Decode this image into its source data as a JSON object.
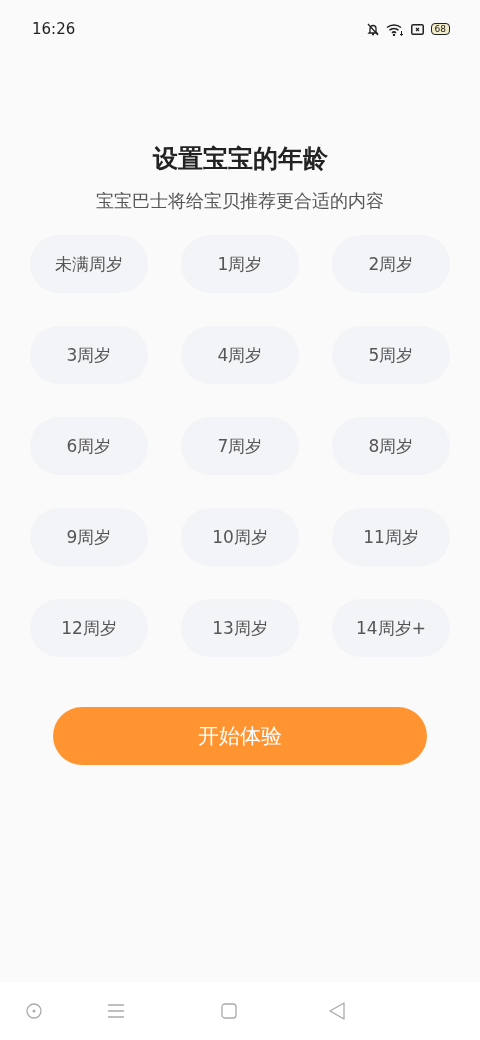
{
  "status_bar": {
    "time": "16:26",
    "battery": "68"
  },
  "title": "设置宝宝的年龄",
  "subtitle": "宝宝巴士将给宝贝推荐更合适的内容",
  "ages": [
    {
      "label": "未满周岁",
      "selected": false
    },
    {
      "label": "1周岁",
      "selected": false
    },
    {
      "label": "2周岁",
      "selected": false
    },
    {
      "label": "3周岁",
      "selected": false
    },
    {
      "label": "4周岁",
      "selected": false
    },
    {
      "label": "5周岁",
      "selected": false
    },
    {
      "label": "6周岁",
      "selected": false
    },
    {
      "label": "7周岁",
      "selected": false
    },
    {
      "label": "8周岁",
      "selected": false
    },
    {
      "label": "9周岁",
      "selected": false
    },
    {
      "label": "10周岁",
      "selected": false
    },
    {
      "label": "11周岁",
      "selected": false
    },
    {
      "label": "12周岁",
      "selected": false
    },
    {
      "label": "13周岁",
      "selected": false
    },
    {
      "label": "14周岁+",
      "selected": false
    }
  ],
  "start_button": "开始体验"
}
